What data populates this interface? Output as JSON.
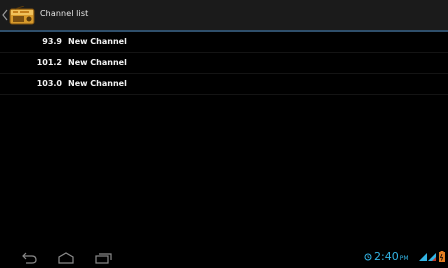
{
  "action_bar": {
    "title": "Channel list",
    "icon": "radio-icon",
    "accent_line_color": "#2f4f6b"
  },
  "channels": [
    {
      "frequency": "93.9",
      "name": "New Channel"
    },
    {
      "frequency": "101.2",
      "name": "New Channel"
    },
    {
      "frequency": "103.0",
      "name": "New Channel"
    }
  ],
  "system_bar": {
    "nav": [
      "back-icon",
      "home-icon",
      "recent-apps-icon"
    ],
    "time": "2:40",
    "ampm": "PM",
    "clock_color": "#33b5e5"
  }
}
